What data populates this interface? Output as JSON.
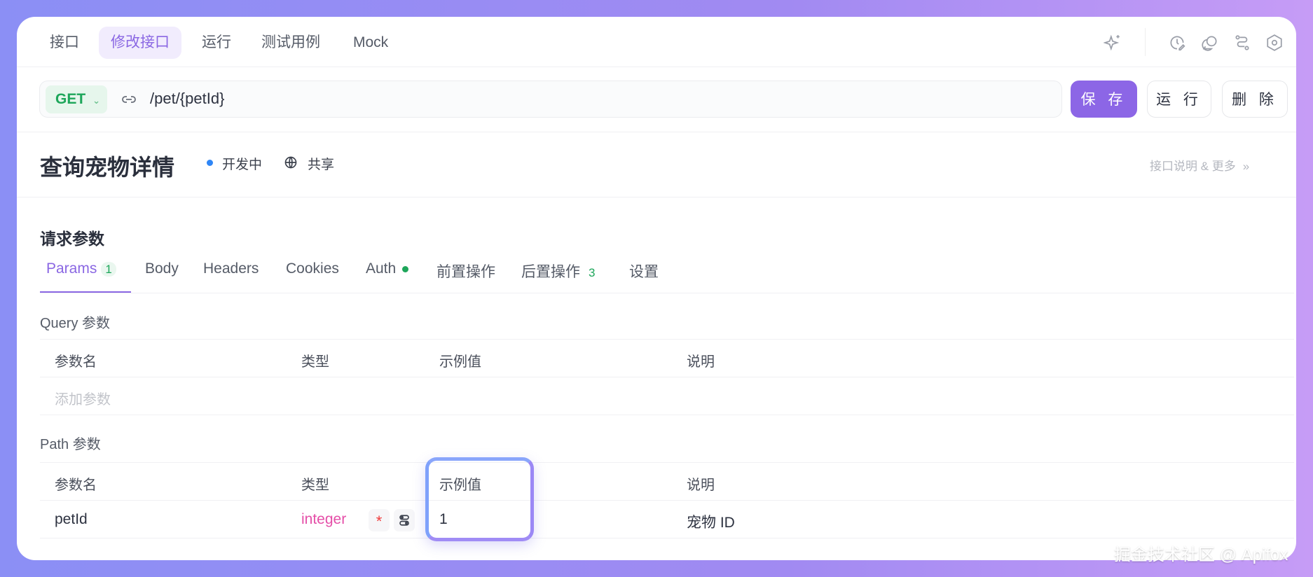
{
  "top_tabs": [
    "接口",
    "修改接口",
    "运行",
    "测试用例",
    "Mock"
  ],
  "active_tab": "修改接口",
  "method": "GET",
  "url": "/pet/{petId}",
  "buttons": {
    "save": "保 存",
    "run": "运 行",
    "delete": "删 除"
  },
  "title": "查询宠物详情",
  "status": "开发中",
  "share": "共享",
  "more": "接口说明 & 更多",
  "section_title": "请求参数",
  "param_tabs": [
    {
      "label": "Params",
      "badge": "1"
    },
    {
      "label": "Body"
    },
    {
      "label": "Headers"
    },
    {
      "label": "Cookies"
    },
    {
      "label": "Auth"
    },
    {
      "label": "前置操作"
    },
    {
      "label": "后置操作",
      "badge": "3"
    },
    {
      "label": "设置"
    }
  ],
  "columns": [
    "参数名",
    "类型",
    "示例值",
    "说明"
  ],
  "query": {
    "label": "Query 参数",
    "add_placeholder": "添加参数"
  },
  "path": {
    "label": "Path 参数",
    "rows": [
      {
        "name": "petId",
        "type": "integer",
        "required": "*",
        "example": "1",
        "desc": "宠物 ID"
      }
    ]
  },
  "watermark": "掘金技术社区 @ Apifox",
  "colors": {
    "accent": "#8a67e3",
    "get": "#1da65a",
    "type": "#e54fa8",
    "status": "#2f86f6"
  }
}
